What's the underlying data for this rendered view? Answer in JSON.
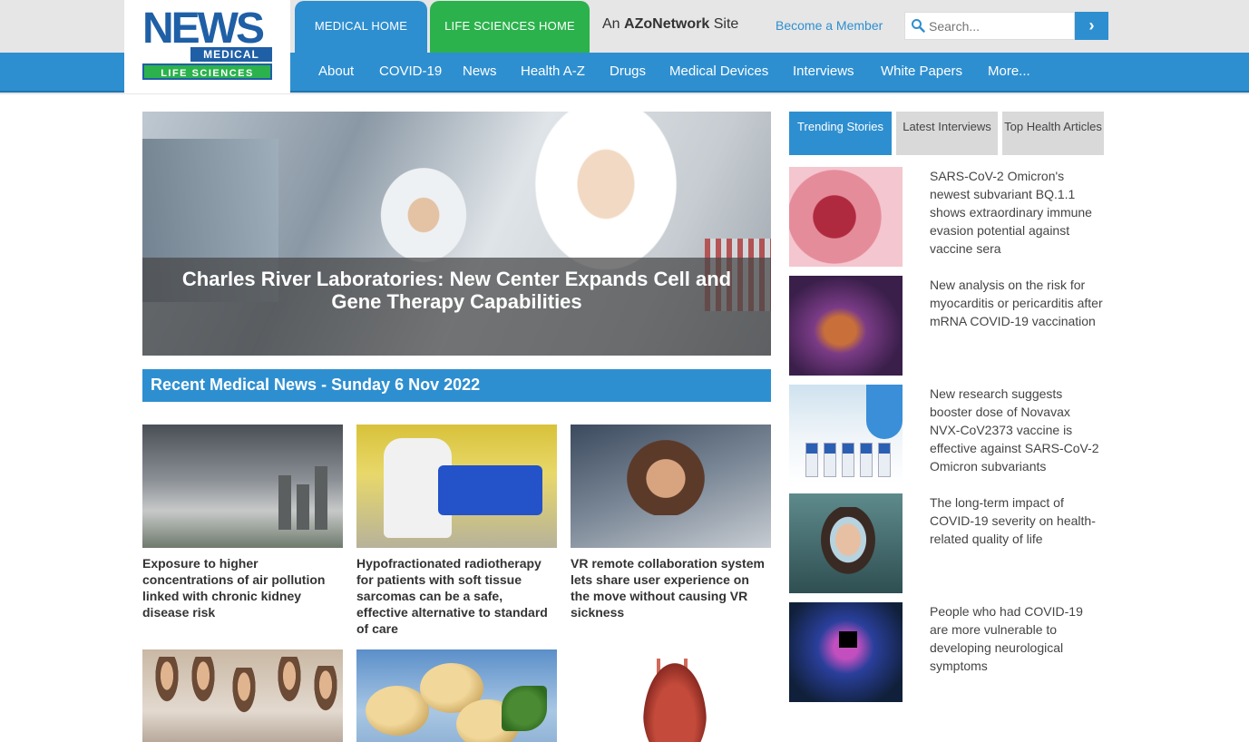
{
  "logo": {
    "news": "NEWS",
    "medical": "MEDICAL",
    "life": "LIFE SCIENCES"
  },
  "top_tabs": {
    "medical_home": "MEDICAL HOME",
    "life_sciences_home": "LIFE SCIENCES HOME"
  },
  "azo_network": {
    "prefix": "An",
    "brand": "AZoNetwork",
    "suffix": "Site"
  },
  "become_member": "Become a Member",
  "search": {
    "placeholder": "Search...",
    "button_glyph": "›"
  },
  "nav": [
    "About",
    "COVID-19",
    "News",
    "Health A-Z",
    "Drugs",
    "Medical Devices",
    "Interviews",
    "White Papers",
    "More..."
  ],
  "hero": {
    "caption": "Charles River Laboratories: New Center Expands Cell and Gene Therapy Capabilities"
  },
  "recent_header": "Recent Medical News - Sunday 6 Nov 2022",
  "cards": [
    {
      "title": "Exposure to higher concentrations of air pollution linked with chronic kidney disease risk"
    },
    {
      "title": "Hypofractionated radiotherapy for patients with soft tissue sarcomas can be a safe, effective alternative to standard of care"
    },
    {
      "title": "VR remote collaboration system lets share user experience on the move without causing VR sickness"
    },
    {
      "title": ""
    },
    {
      "title": ""
    },
    {
      "title": ""
    }
  ],
  "sidebar": {
    "tabs": [
      "Trending Stories",
      "Latest Interviews",
      "Top Health Articles"
    ],
    "items": [
      {
        "text": "SARS-CoV-2 Omicron's newest subvariant BQ.1.1 shows extraordinary immune evasion potential against vaccine sera"
      },
      {
        "text": "New analysis on the risk for myocarditis or pericarditis after mRNA COVID-19 vaccination"
      },
      {
        "text": "New research suggests booster dose of Novavax NVX-CoV2373 vaccine is effective against SARS-CoV-2 Omicron subvariants"
      },
      {
        "text": "The long-term impact of COVID-19 severity on health-related quality of life"
      },
      {
        "text": "People who had COVID-19 are more vulnerable to developing neurological symptoms"
      }
    ]
  },
  "colors": {
    "primary_blue": "#2e8fd0",
    "green": "#2bb24c",
    "logo_blue": "#1f5fa6"
  }
}
